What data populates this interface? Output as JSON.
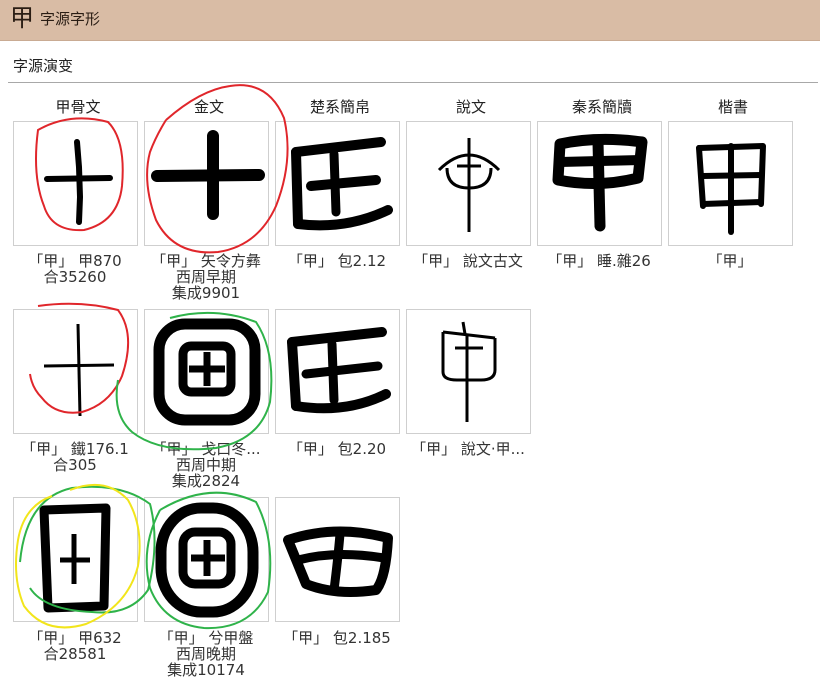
{
  "header": {
    "char": "甲",
    "title": "字源字形"
  },
  "section": {
    "label": "字源演变"
  },
  "columns": [
    "甲骨文",
    "金文",
    "楚系簡帛",
    "說文",
    "秦系簡牘",
    "楷書"
  ],
  "glyph_cells": [
    {
      "glyph": "oracle-cross-tall-icon",
      "lines": [
        "「甲」 甲870",
        "合35260"
      ]
    },
    {
      "glyph": "bronze-cross-icon",
      "lines": [
        "「甲」 矢令方彝",
        "西周早期",
        "集成9901"
      ]
    },
    {
      "glyph": "chu-jia-icon",
      "lines": [
        "「甲」 包2.12"
      ]
    },
    {
      "glyph": "shuowen-jia-icon",
      "lines": [
        "「甲」 說文古文"
      ]
    },
    {
      "glyph": "qin-jia-icon",
      "lines": [
        "「甲」 睡.雜26"
      ]
    },
    {
      "glyph": "kaishu-jia-icon",
      "lines": [
        "「甲」"
      ]
    },
    {
      "glyph": "oracle-cross-thin-icon",
      "lines": [
        "「甲」 鐵176.1",
        "合305"
      ]
    },
    {
      "glyph": "bronze-boxed-cross-icon",
      "lines": [
        "「甲」 戈口冬...",
        "西周中期",
        "集成2824"
      ]
    },
    {
      "glyph": "chu-jia-variant-icon",
      "lines": [
        "「甲」 包2.20"
      ]
    },
    {
      "glyph": "shuowen-jia-variant-icon",
      "lines": [
        "「甲」 說文·甲..."
      ]
    },
    {
      "glyph": "oracle-boxed-cross-icon",
      "lines": [
        "「甲」 甲632",
        "合28581"
      ]
    },
    {
      "glyph": "bronze-round-cross-icon",
      "lines": [
        "「甲」 兮甲盤",
        "西周晚期",
        "集成10174"
      ]
    },
    {
      "glyph": "chu-jia-flat-icon",
      "lines": [
        "「甲」 包2.185"
      ]
    }
  ],
  "annotation_colors": {
    "red": "#e0262b",
    "green": "#2fb34a",
    "yellow": "#f2e51b"
  }
}
